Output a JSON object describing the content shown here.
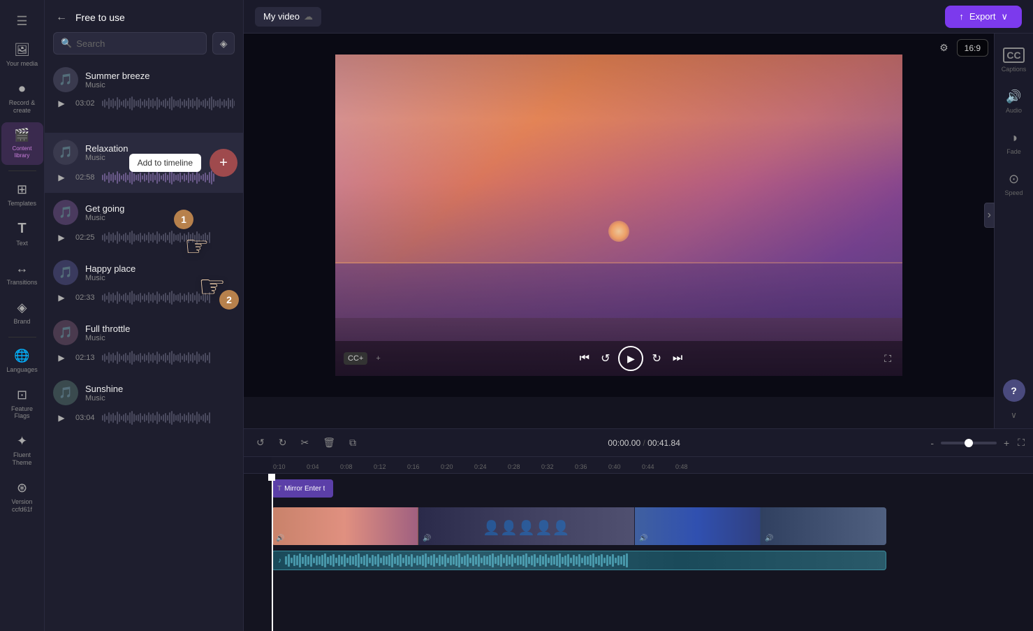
{
  "app": {
    "title": "Free to use"
  },
  "topbar": {
    "tab_myvideo": "My video",
    "export_label": "Export",
    "save_icon": "💾"
  },
  "sidebar": {
    "items": [
      {
        "id": "your-media",
        "icon": "🖼",
        "label": "Your media"
      },
      {
        "id": "record-create",
        "icon": "⏺",
        "label": "Record & create"
      },
      {
        "id": "content-library",
        "icon": "🎬",
        "label": "Content library",
        "active": true
      },
      {
        "id": "templates",
        "icon": "⊞",
        "label": "Templates"
      },
      {
        "id": "text",
        "icon": "T",
        "label": "Text"
      },
      {
        "id": "transitions",
        "icon": "↔",
        "label": "Transitions"
      },
      {
        "id": "brand-kit",
        "icon": "◈",
        "label": "Brand"
      },
      {
        "id": "languages",
        "icon": "🌐",
        "label": "Languages"
      },
      {
        "id": "feature-flags",
        "icon": "⊡",
        "label": "Feature Flags"
      },
      {
        "id": "fluent-theme",
        "icon": "✦",
        "label": "Fluent Theme"
      },
      {
        "id": "version",
        "icon": "⊛",
        "label": "Version ccfd61f"
      }
    ]
  },
  "panel": {
    "back_label": "←",
    "title": "Free to use",
    "search_placeholder": "Search",
    "premium_icon": "◈",
    "music_list": [
      {
        "id": "summer-breeze",
        "name": "Summer breeze",
        "genre": "Music",
        "duration": "03:02",
        "active": false
      },
      {
        "id": "relaxation",
        "name": "Relaxation",
        "genre": "Music",
        "duration": "02:58",
        "active": true,
        "show_add": true
      },
      {
        "id": "get-going",
        "name": "Get going",
        "genre": "Music",
        "duration": "02:25",
        "active": false
      },
      {
        "id": "happy-place",
        "name": "Happy place",
        "genre": "Music",
        "duration": "02:33",
        "active": false
      },
      {
        "id": "full-throttle",
        "name": "Full throttle",
        "genre": "Music",
        "duration": "02:13",
        "active": false
      },
      {
        "id": "sunshine",
        "name": "Sunshine",
        "genre": "Music",
        "duration": "03:04",
        "active": false
      }
    ],
    "add_to_timeline": "Add to timeline"
  },
  "right_sidebar": {
    "items": [
      {
        "id": "captions",
        "icon": "CC",
        "label": "Captions"
      },
      {
        "id": "audio",
        "icon": "🔊",
        "label": "Audio"
      },
      {
        "id": "fade",
        "icon": "◑",
        "label": "Fade"
      },
      {
        "id": "speed",
        "icon": "⊙",
        "label": "Speed"
      }
    ]
  },
  "video_preview": {
    "cc_label": "CC+",
    "aspect_ratio": "16:9",
    "time_current": "00:00.00",
    "time_total": "00:41.84"
  },
  "timeline": {
    "time_display": "00:00.00 / 00:41.84",
    "ruler_marks": [
      "0:10",
      "0:04",
      "0:08",
      "0:12",
      "0:16",
      "0:20",
      "0:24",
      "0:28",
      "0:32",
      "0:36",
      "0:40",
      "0:44",
      "0:48"
    ],
    "text_clip": "Mirror Enter t",
    "audio_clip_exists": true
  }
}
